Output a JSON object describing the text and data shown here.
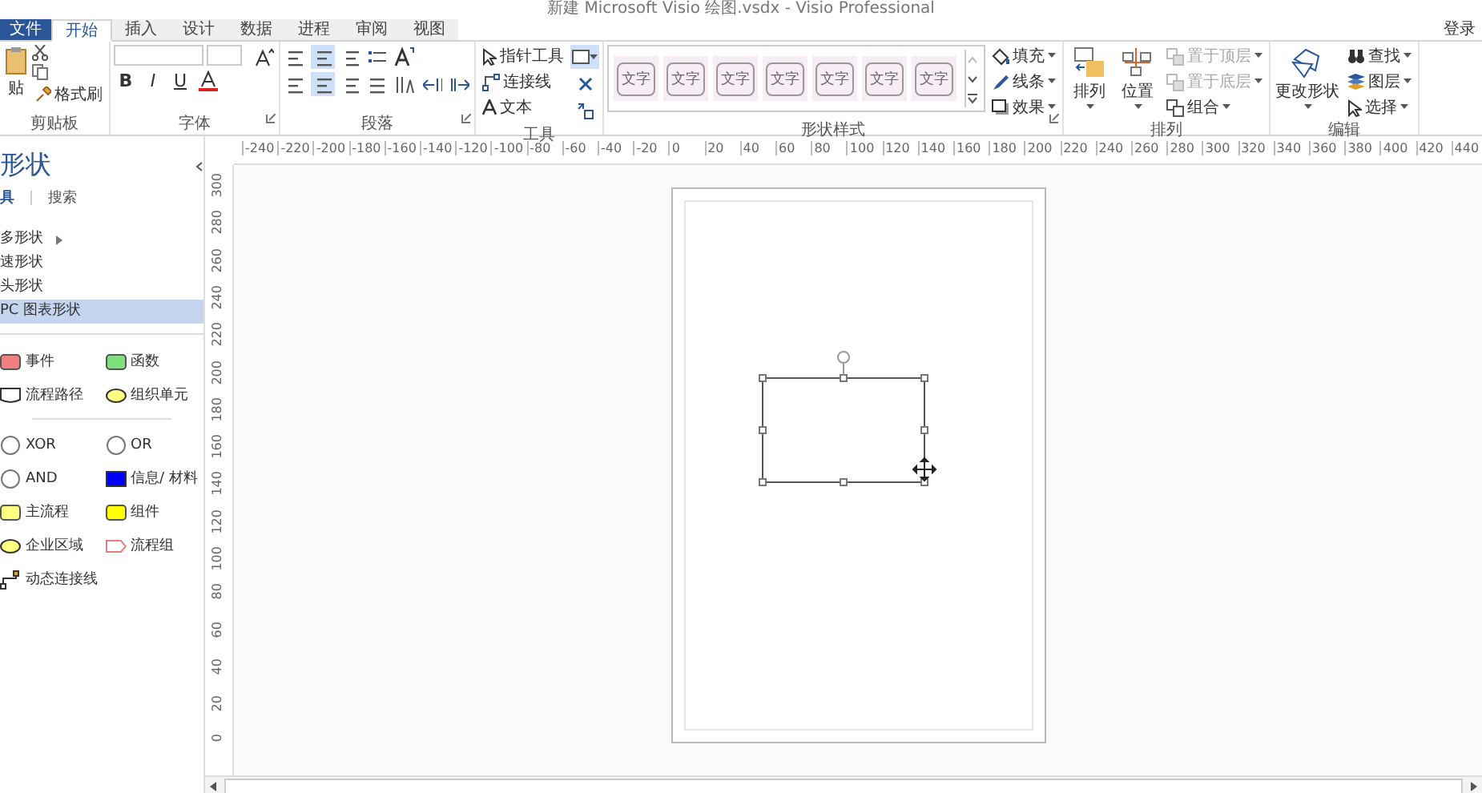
{
  "window": {
    "title": "新建 Microsoft Visio 绘图.vsdx - Visio Professional",
    "sign_in": "登录"
  },
  "tabs": [
    {
      "label": "文件",
      "kind": "file",
      "selected": false
    },
    {
      "label": "开始",
      "kind": "tab",
      "selected": true
    },
    {
      "label": "插入",
      "kind": "tab",
      "selected": false
    },
    {
      "label": "设计",
      "kind": "tab",
      "selected": false
    },
    {
      "label": "数据",
      "kind": "tab",
      "selected": false
    },
    {
      "label": "进程",
      "kind": "tab",
      "selected": false
    },
    {
      "label": "审阅",
      "kind": "tab",
      "selected": false
    },
    {
      "label": "视图",
      "kind": "tab",
      "selected": false
    }
  ],
  "ribbon": {
    "groups": [
      {
        "kind": "clipboard",
        "label": "剪贴板",
        "paste": "贴",
        "format_painter": "格式刷"
      },
      {
        "kind": "font",
        "label": "字体",
        "bold": "B",
        "italic": "I",
        "underline": "U"
      },
      {
        "kind": "paragraph",
        "label": "段落"
      },
      {
        "kind": "tools",
        "label": "工具",
        "items": [
          "指针工具",
          "连接线",
          "文本"
        ]
      },
      {
        "kind": "styles",
        "label": "形状样式",
        "swatches": [
          "文字",
          "文字",
          "文字",
          "文字",
          "文字",
          "文字",
          "文字"
        ],
        "items": [
          "填充",
          "线条",
          "效果"
        ]
      },
      {
        "kind": "arrange",
        "label": "排列",
        "large": [
          "排列",
          "位置"
        ],
        "items": [
          {
            "label": "置于顶层",
            "disabled": true
          },
          {
            "label": "置于底层",
            "disabled": true
          },
          {
            "label": "组合",
            "disabled": false
          }
        ]
      },
      {
        "kind": "editing",
        "label": "编辑",
        "large": "更改形状",
        "items": [
          "查找",
          "图层",
          "选择"
        ]
      }
    ]
  },
  "shapes_panel": {
    "title": "形状",
    "tabs": [
      {
        "label": "具",
        "selected": true
      },
      {
        "label": "搜索",
        "selected": false
      }
    ],
    "categories": [
      {
        "label": "多形状",
        "submenu": true,
        "selected": false
      },
      {
        "label": "速形状",
        "submenu": false,
        "selected": false
      },
      {
        "label": "头形状",
        "submenu": false,
        "selected": false
      },
      {
        "label": "PC 图表形状",
        "submenu": false,
        "selected": true
      }
    ],
    "shape_groups": [
      [
        {
          "label": "事件",
          "kind": "rounded",
          "color": "#f08080"
        },
        {
          "label": "函数",
          "kind": "rounded",
          "color": "#80e080"
        },
        {
          "label": "流程路径",
          "kind": "doc"
        },
        {
          "label": "组织单元",
          "kind": "ellipse",
          "color": "#ffff80"
        }
      ],
      [
        {
          "label": "XOR",
          "kind": "circle"
        },
        {
          "label": "OR",
          "kind": "circle"
        },
        {
          "label": "AND",
          "kind": "circle"
        },
        {
          "label": "信息/ 材料",
          "kind": "rect",
          "color": "#0000ff"
        },
        {
          "label": "主流程",
          "kind": "rounded",
          "color": "#ffff80"
        },
        {
          "label": "组件",
          "kind": "rounded",
          "color": "#ffff00"
        },
        {
          "label": "企业区域",
          "kind": "ellipse",
          "color": "#ffff80"
        },
        {
          "label": "流程组",
          "kind": "arrow"
        },
        {
          "label": "动态连接线",
          "kind": "connector"
        }
      ]
    ]
  },
  "canvas": {
    "h_ruler": [
      "-240",
      "-220",
      "-200",
      "-180",
      "-160",
      "-140",
      "-120",
      "-100",
      "-80",
      "-60",
      "-40",
      "-20",
      "0",
      "20",
      "40",
      "60",
      "80",
      "100",
      "120",
      "140",
      "160",
      "180",
      "200",
      "220",
      "240",
      "260",
      "280",
      "300",
      "320",
      "340",
      "360",
      "380",
      "400",
      "420",
      "440"
    ],
    "v_ruler": [
      "300",
      "280",
      "260",
      "240",
      "220",
      "200",
      "180",
      "160",
      "140",
      "120",
      "100",
      "80",
      "60",
      "40",
      "20",
      "0"
    ],
    "shape": {
      "kind": "rectangle",
      "selected": true
    }
  }
}
